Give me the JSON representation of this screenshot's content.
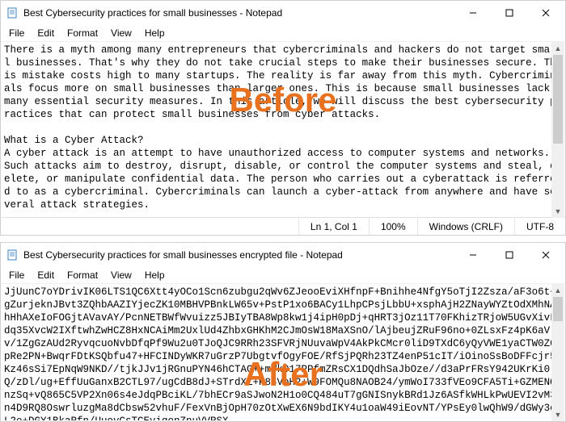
{
  "before": {
    "title": "Best Cybersecurity practices for small businesses - Notepad",
    "menu": [
      "File",
      "Edit",
      "Format",
      "View",
      "Help"
    ],
    "text": "There is a myth among many entrepreneurs that cybercriminals and hackers do not target small businesses. That's why they do not take crucial steps to make their businesses secure. This mistake costs high to many startups. The reality is far away from this myth. Cybercriminals focus more on small businesses than larger ones. This is because small businesses lack many essential security measures. In this article, we will discuss the best cybersecurity practices that can protect small businesses from cyber attacks.\n\nWhat is a Cyber Attack?\nA cyber attack is an attempt to have unauthorized access to computer systems and networks. Such attacks aim to destroy, disrupt, disable, or control the computer systems and steal, delete, or manipulate confidential data. The person who carries out a cyberattack is referred to as a cybercriminal. Cybercriminals can launch a cyber-attack from anywhere and have several attack strategies.",
    "status": {
      "pos": "Ln 1, Col 1",
      "zoom": "100%",
      "eol": "Windows (CRLF)",
      "encoding": "UTF-8"
    }
  },
  "after": {
    "title": "Best Cybersecurity practices for small businesses encrypted file - Notepad",
    "menu": [
      "File",
      "Edit",
      "Format",
      "View",
      "Help"
    ],
    "text": "JjUunC7oYDrivIK06LTS1QC6Xtt4yOCo1Scn6zubgu2qWv6ZJeooEviXHfnpF+Bnihhe4NfgY5oTjI2Zsza/aF3o6t+gZurjeknJBvt3ZQhbAAZIYjecZK10MBHVPBnkLW65v+PstP1xo6BACy1LhpCPsjLbbU+xsphAjH2ZNayWYZtOdXMhNAhHhAXeIoFOGjtAVavAY/PcnNETBWfWvuizz5JBIyTBA8Wp8kw1j4ipH0pDj+qHRT3jOz11T70FKhizTRjoW5UGvXivLdq35XvcW2IXftwhZwHCZ8HxNCAiMm2UxlUd4ZhbxGHKhM2CJmOsW18MaXSnO/lAjbeujZRuF96no+0ZLsxFz4pK6aVv/1ZgGzAUd2RyvqcuoNvbDfqPf9Wu2u0TJoQJC9RRh23SFVRjNUuvaWpV4AkPkCMcr0liD9TXdC6yQyVWE1yaCTW0Z0pRe2PN+BwqrFDtKSQbfu47+HFCINDyWKR7uGrzP7UbgtvfOgyFOE/RfSjPQRh23TZ4enP51cIT/iOinoSsBoDFFcjr5Kz46sSi7EpNqW9NKD//tjkJJv1jRGnuPYN46hCTAG++mVk017PPfmZRsCX1DQdhSaJbOze//d3aPrFRsY942UKrKi0Q/zDl/ug+EffUuGanxB2CTL97/ugCdB8dJ+STrdXZ+P84VoH2+W9FOMQu8NAOB24/ymWoI733fVEo9CFA5Ti+GZMENQnzSq+vQ865C5VP2Xn06s4eJdqPBciKL/7bhECr9aSJwoN2H1o0CQ484uT7gGNISnykBRd1Jz6ASfkWHLkPwUEVI2vM3n4D9RQ8Oswrluzg​Ma8dCbsw52vhuF/FexVnBjOpH70zOtXwEX6N9bdIKY4u1oaW49iEovNT/YPsEy0lwQhW9/dGWy3cL2o+DGY1BkaRfn/UuoyCsTCEyiqonZnuVVRSX"
  },
  "labels": {
    "before": "Before",
    "after": "After"
  }
}
